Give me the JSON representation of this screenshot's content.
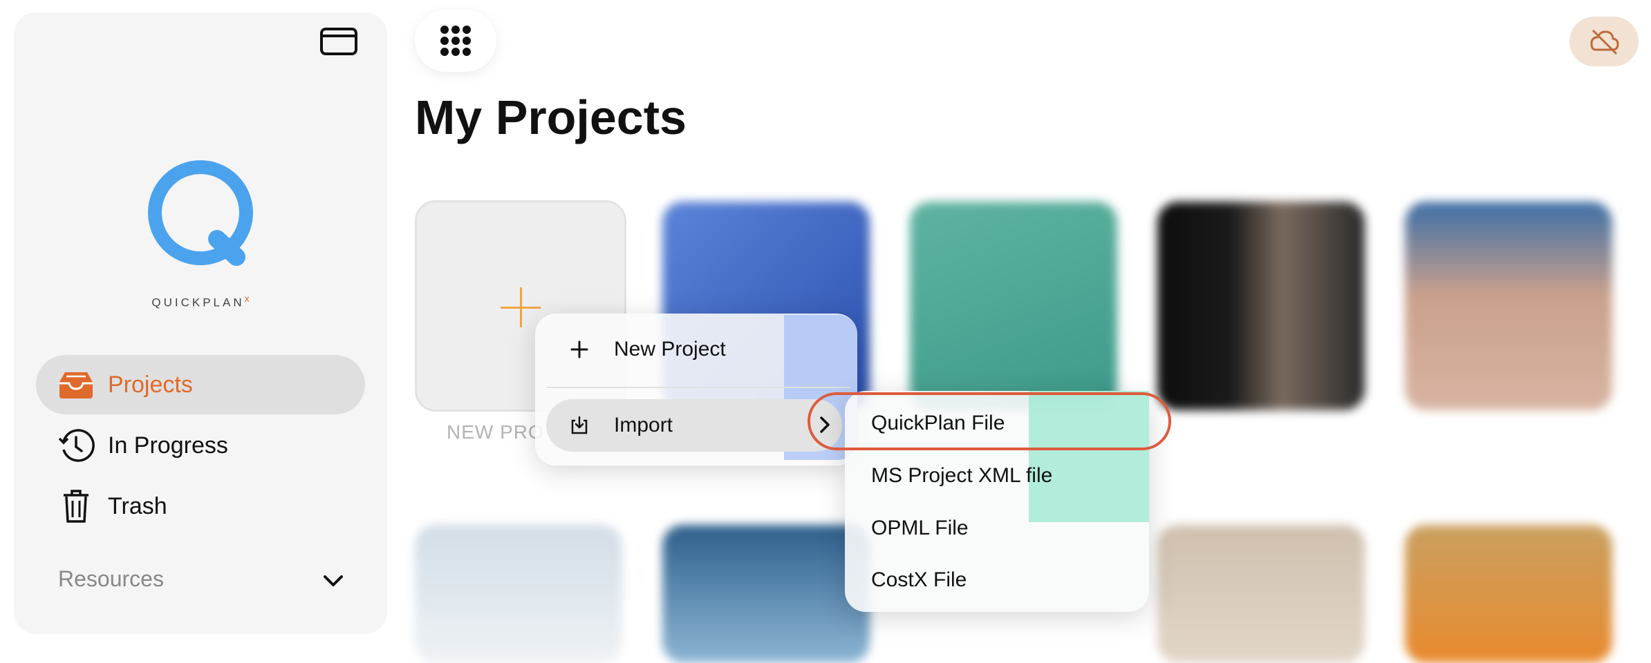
{
  "sidebar": {
    "logo_text": "QUICKPLAN",
    "logo_mark": "x",
    "items": [
      {
        "label": "Projects",
        "icon": "tray-icon",
        "active": true
      },
      {
        "label": "In Progress",
        "icon": "history-icon",
        "active": false
      },
      {
        "label": "Trash",
        "icon": "trash-icon",
        "active": false
      }
    ],
    "resources_label": "Resources"
  },
  "header": {
    "title": "My Projects"
  },
  "tiles": {
    "new_label": "NEW PRO"
  },
  "context_menu": {
    "items": [
      {
        "label": "New Project",
        "icon": "plus-icon"
      },
      {
        "label": "Import",
        "icon": "import-icon",
        "has_submenu": true
      }
    ]
  },
  "import_submenu": {
    "items": [
      {
        "label": "QuickPlan File",
        "highlighted": true
      },
      {
        "label": "MS Project XML file"
      },
      {
        "label": "OPML File"
      },
      {
        "label": "CostX File"
      }
    ]
  },
  "colors": {
    "accent": "#e06a2b",
    "logo_blue": "#4ba3ee",
    "highlight_ring": "#dc5c3c",
    "cloud_bg": "#f1e2d4"
  }
}
